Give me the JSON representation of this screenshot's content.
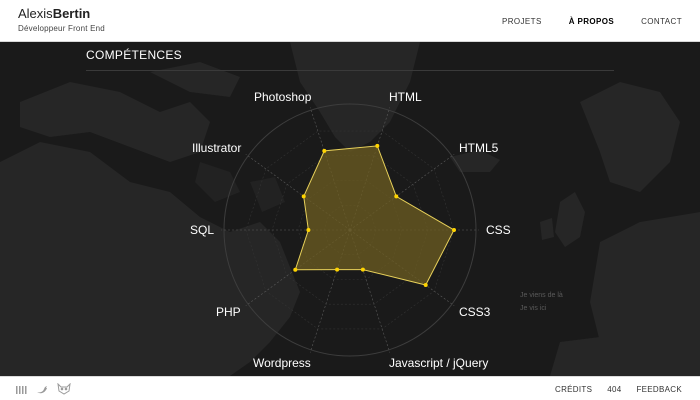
{
  "header": {
    "first_name": "Alexis",
    "last_name": "Bertin",
    "tagline": "Développeur Front End",
    "nav": [
      {
        "label": "PROJETS",
        "active": false
      },
      {
        "label": "À PROPOS",
        "active": true
      },
      {
        "label": "CONTACT",
        "active": false
      }
    ]
  },
  "main": {
    "section_title": "COMPÉTENCES",
    "notes": [
      "Je viens de là",
      "Je vis ici"
    ]
  },
  "chart_data": {
    "type": "radar",
    "categories": [
      "HTML",
      "HTML5",
      "CSS",
      "CSS3",
      "Javascript / jQuery",
      "Wordpress",
      "PHP",
      "SQL",
      "Illustrator",
      "Photoshop"
    ],
    "values": [
      85,
      55,
      100,
      90,
      40,
      40,
      65,
      40,
      55,
      80
    ],
    "max": 100,
    "fill_color": "#6e5d22",
    "stroke_color": "#e8d15a"
  },
  "footer": {
    "social_icons": [
      "linkedin-icon",
      "twitter-icon",
      "codepen-icon"
    ],
    "links": [
      "CRÉDITS",
      "404",
      "FEEDBACK"
    ]
  }
}
